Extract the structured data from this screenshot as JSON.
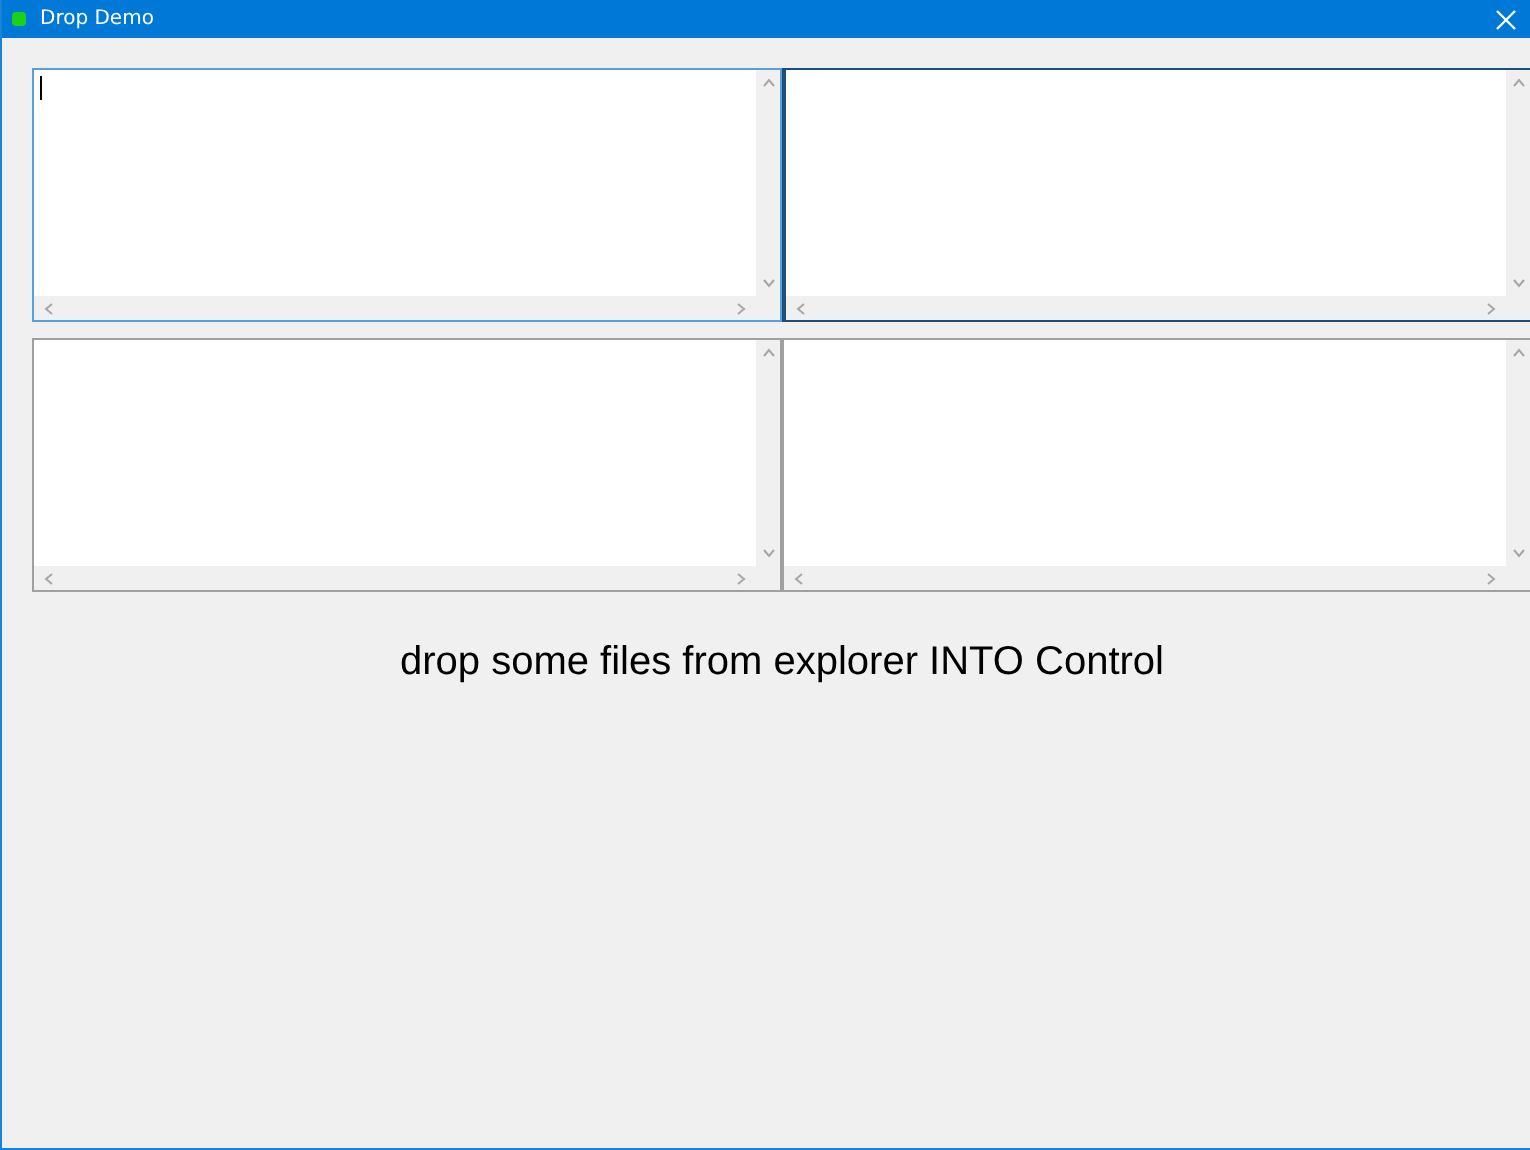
{
  "window": {
    "title": "Drop Demo"
  },
  "text_areas": [
    {
      "focused": true,
      "hovered": false
    },
    {
      "focused": false,
      "hovered": true
    },
    {
      "focused": false,
      "hovered": false
    },
    {
      "focused": false,
      "hovered": false
    }
  ],
  "instruction": "drop some files from explorer INTO Control"
}
